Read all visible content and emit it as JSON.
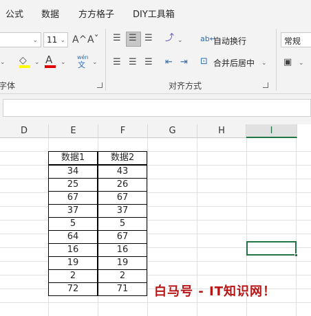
{
  "tabs": [
    "公式",
    "数据",
    "方方格子",
    "DIY工具箱"
  ],
  "font_group": {
    "size_value": "11",
    "grow_icon": "A^",
    "shrink_icon": "Aˇ",
    "phonetic_top": "wén",
    "phonetic_bottom": "文",
    "label": "字体"
  },
  "alignment_group": {
    "wrap_text": "自动换行",
    "merge_center": "合并后居中",
    "label": "对齐方式"
  },
  "number_group": {
    "format_value": "常规"
  },
  "columns": [
    "D",
    "E",
    "F",
    "G",
    "H",
    "I"
  ],
  "table": {
    "headers": [
      "数据1",
      "数据2"
    ],
    "rows": [
      [
        "34",
        "43"
      ],
      [
        "25",
        "26"
      ],
      [
        "67",
        "67"
      ],
      [
        "37",
        "37"
      ],
      [
        "5",
        "5"
      ],
      [
        "64",
        "67"
      ],
      [
        "16",
        "16"
      ],
      [
        "19",
        "19"
      ],
      [
        "2",
        "2"
      ],
      [
        "72",
        "71"
      ]
    ]
  },
  "watermark": "白马号 - IT知识网！",
  "colors": {
    "accent": "#217346",
    "font_color": "#e00000",
    "highlight": "#ffff00",
    "watermark": "#b81414"
  }
}
